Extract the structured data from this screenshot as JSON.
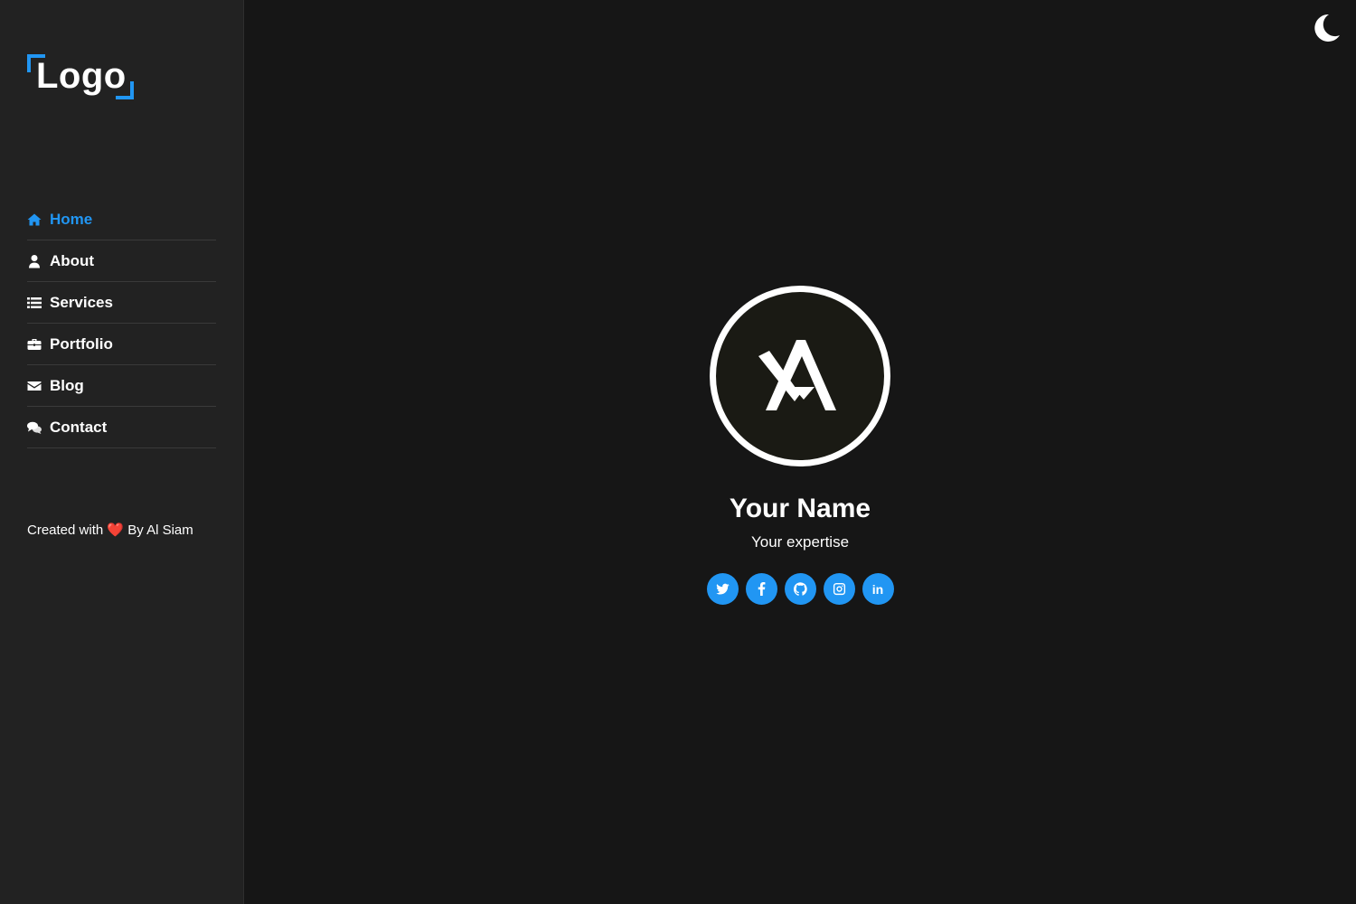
{
  "logo": {
    "text": "Logo",
    "accent": "#2196f3"
  },
  "nav": {
    "items": [
      {
        "label": "Home",
        "icon": "home-icon",
        "active": true
      },
      {
        "label": "About",
        "icon": "user-icon",
        "active": false
      },
      {
        "label": "Services",
        "icon": "list-icon",
        "active": false
      },
      {
        "label": "Portfolio",
        "icon": "briefcase-icon",
        "active": false
      },
      {
        "label": "Blog",
        "icon": "envelope-icon",
        "active": false
      },
      {
        "label": "Contact",
        "icon": "comments-icon",
        "active": false
      }
    ]
  },
  "credit": {
    "prefix": "Created with",
    "heart": "❤️",
    "suffix": "By Al Siam"
  },
  "theme_toggle": {
    "icon": "moon-icon"
  },
  "hero": {
    "name": "Your Name",
    "expertise": "Your expertise",
    "socials": [
      {
        "icon": "twitter-icon"
      },
      {
        "icon": "facebook-icon"
      },
      {
        "icon": "github-icon"
      },
      {
        "icon": "instagram-icon"
      },
      {
        "icon": "linkedin-icon",
        "text": "in"
      }
    ]
  },
  "colors": {
    "accent": "#2196f3",
    "background": "#161616",
    "sidebar": "#222222"
  }
}
